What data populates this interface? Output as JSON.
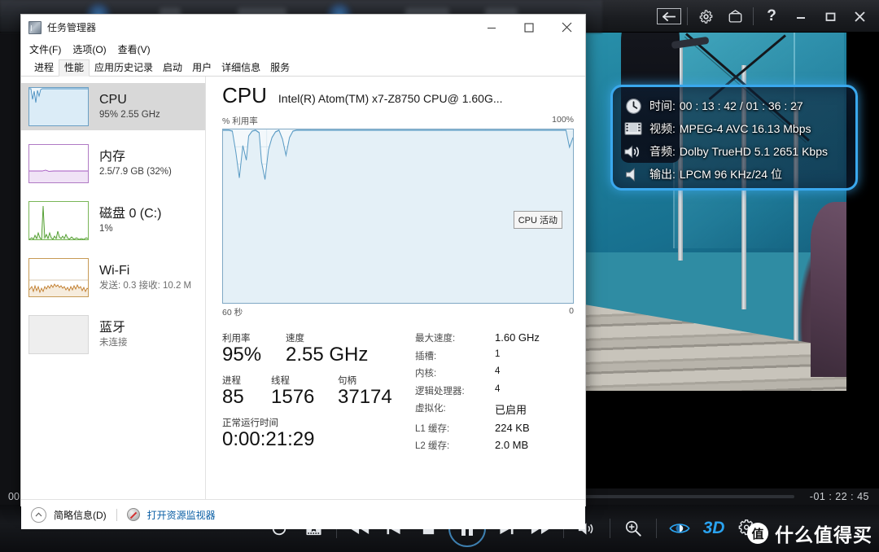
{
  "player": {
    "topbar": {
      "back_icon": "back-arrow-icon",
      "settings_icon": "gear-icon",
      "tv_icon": "tv-icon",
      "help_icon": "question-mark-icon",
      "minimize_icon": "minimize-icon",
      "maximize_icon": "maximize-icon",
      "close_icon": "close-icon"
    },
    "seek": {
      "current_time": "00",
      "remaining_time": "-01 : 22 : 45",
      "progress_percent": 14
    },
    "controls": [
      {
        "name": "replay-button",
        "icon": "circular-arrow-icon"
      },
      {
        "name": "snapshot-button",
        "icon": "star-frame-icon"
      },
      {
        "name": "rewind-button",
        "icon": "rewind-icon"
      },
      {
        "name": "previous-button",
        "icon": "skip-previous-icon"
      },
      {
        "name": "stop-button",
        "icon": "stop-square-icon"
      },
      {
        "name": "play-pause-button",
        "icon": "pause-icon"
      },
      {
        "name": "next-button",
        "icon": "skip-next-icon"
      },
      {
        "name": "fast-forward-button",
        "icon": "fast-forward-icon"
      },
      {
        "name": "volume-button",
        "icon": "speaker-icon"
      },
      {
        "name": "zoom-button",
        "icon": "magnifier-plus-icon"
      },
      {
        "name": "eye-view-button",
        "icon": "eye-icon"
      },
      {
        "name": "mode-3d-button",
        "icon": "3d-badge"
      },
      {
        "name": "settings-button",
        "icon": "gears-icon"
      }
    ],
    "badge_3d": "3D",
    "watermark": {
      "mark": "值",
      "text": "什么值得买"
    }
  },
  "osd": {
    "rows": [
      {
        "icon": "clock-icon",
        "label": "时间:",
        "value": "00 : 13 : 42 / 01 : 36 : 27"
      },
      {
        "icon": "film-icon",
        "label": "视频:",
        "value": "MPEG-4 AVC  16.13 Mbps"
      },
      {
        "icon": "speaker-waves-icon",
        "label": "音频:",
        "value": "Dolby TrueHD 5.1  2651 Kbps"
      },
      {
        "icon": "speaker-icon",
        "label": "输出:",
        "value": "LPCM  96 KHz/24 位"
      }
    ],
    "border_color": "#3aa8ee"
  },
  "taskmgr": {
    "title": "任务管理器",
    "window_buttons": {
      "minimize": "minimize-icon",
      "maximize": "maximize-icon",
      "close": "close-icon"
    },
    "menu": [
      "文件(F)",
      "选项(O)",
      "查看(V)"
    ],
    "tabs": [
      {
        "label": "进程",
        "active": false
      },
      {
        "label": "性能",
        "active": true
      },
      {
        "label": "应用历史记录",
        "active": false
      },
      {
        "label": "启动",
        "active": false
      },
      {
        "label": "用户",
        "active": false
      },
      {
        "label": "详细信息",
        "active": false
      },
      {
        "label": "服务",
        "active": false
      }
    ],
    "sidebar": [
      {
        "name": "CPU",
        "sub": "95% 2.55 GHz",
        "selected": true,
        "color": "#4a8fc0",
        "gray": false
      },
      {
        "name": "内存",
        "sub": "2.5/7.9 GB (32%)",
        "selected": false,
        "color": "#a457c0",
        "gray": false
      },
      {
        "name": "磁盘 0 (C:)",
        "sub": "1%",
        "selected": false,
        "color": "#4c9a2a",
        "gray": false
      },
      {
        "name": "Wi-Fi",
        "sub": "发送: 0.3 接收: 10.2 M",
        "selected": false,
        "color": "#c07b2a",
        "gray": true
      },
      {
        "name": "蓝牙",
        "sub": "未连接",
        "selected": false,
        "color": "#c8c8c8",
        "gray": true
      }
    ],
    "main": {
      "title": "CPU",
      "subtitle": "Intel(R) Atom(TM) x7-Z8750 CPU@ 1.60G...",
      "graph_ylabel": "% 利用率",
      "graph_ymax": "100%",
      "graph_xleft": "60 秒",
      "graph_xright": "0",
      "graph_tooltip": "CPU 活动",
      "stats": [
        {
          "key": "利用率",
          "value": "95%"
        },
        {
          "key": "速度",
          "value": "2.55 GHz"
        },
        {
          "key": "进程",
          "value": "85"
        },
        {
          "key": "线程",
          "value": "1576"
        },
        {
          "key": "句柄",
          "value": "37174"
        },
        {
          "key": "正常运行时间",
          "value": "0:00:21:29"
        }
      ],
      "specs": [
        {
          "key": "最大速度:",
          "value": "1.60 GHz"
        },
        {
          "key": "插槽:",
          "value": "1"
        },
        {
          "key": "内核:",
          "value": "4"
        },
        {
          "key": "逻辑处理器:",
          "value": "4"
        },
        {
          "key": "虚拟化:",
          "value": "已启用"
        },
        {
          "key": "L1 缓存:",
          "value": "224 KB"
        },
        {
          "key": "L2 缓存:",
          "value": "2.0 MB"
        }
      ]
    },
    "status": {
      "fewer_details": "简略信息(D)",
      "resource_monitor": "打开资源监视器",
      "chevron_icon": "chevron-up-icon",
      "resmon_icon": "resource-monitor-icon"
    }
  },
  "chart_data": {
    "type": "area",
    "title": "CPU 利用率",
    "ylabel": "% 利用率",
    "xlabel": "60 秒",
    "ylim": [
      0,
      100
    ],
    "xlim": [
      60,
      0
    ],
    "grid": true,
    "series": [
      {
        "name": "CPU",
        "color": "#5a9bc4",
        "fill": "#e4f0f7",
        "values": [
          100,
          72,
          100,
          54,
          100,
          82,
          100,
          100,
          62,
          49,
          100,
          100,
          86,
          100,
          87,
          100,
          100,
          100,
          100,
          100,
          100,
          100,
          100,
          100,
          100,
          100,
          100,
          100,
          100,
          100,
          100,
          100,
          100,
          100,
          100,
          100,
          100,
          100,
          100,
          100,
          100,
          100,
          100,
          100,
          100,
          100,
          100,
          100,
          100,
          100,
          100,
          100,
          100,
          100,
          100,
          100,
          100,
          100,
          95,
          88
        ]
      }
    ]
  }
}
